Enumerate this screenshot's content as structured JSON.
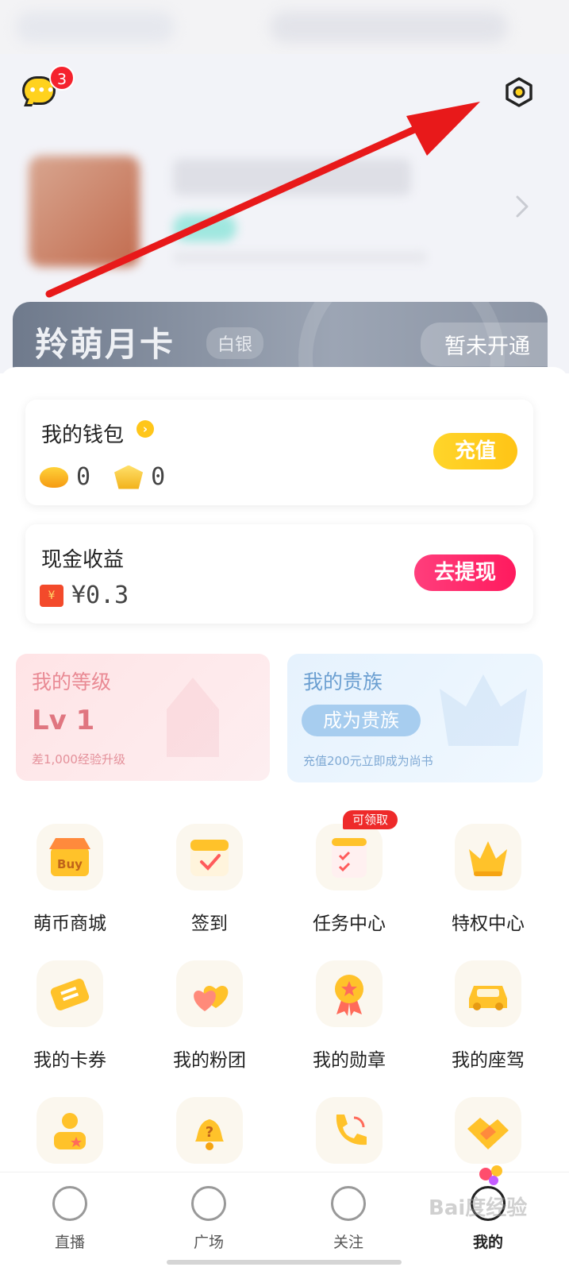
{
  "header": {
    "message_badge": "3",
    "message_icon": "chat-bubble-icon",
    "settings_icon": "gear-icon"
  },
  "moon_card": {
    "title": "羚萌月卡",
    "tier": "白银",
    "status": "暂未开通"
  },
  "wallet": {
    "title": "我的钱包",
    "bean_count": "0",
    "gold_count": "0",
    "recharge_label": "充值"
  },
  "earnings": {
    "title": "现金收益",
    "amount": "¥0.3",
    "withdraw_label": "去提现"
  },
  "level": {
    "title": "我的等级",
    "value": "Lv 1",
    "hint": "差1,000经验升级"
  },
  "noble": {
    "title": "我的贵族",
    "button": "成为贵族",
    "hint": "充值200元立即成为尚书"
  },
  "grid": [
    {
      "label": "萌币商城",
      "icon": "shop-icon"
    },
    {
      "label": "签到",
      "icon": "calendar-check-icon"
    },
    {
      "label": "任务中心",
      "icon": "task-list-icon",
      "badge": "可领取"
    },
    {
      "label": "特权中心",
      "icon": "crown-icon"
    },
    {
      "label": "我的卡券",
      "icon": "ticket-icon"
    },
    {
      "label": "我的粉团",
      "icon": "hearts-icon"
    },
    {
      "label": "我的勋章",
      "icon": "medal-icon"
    },
    {
      "label": "我的座驾",
      "icon": "car-icon"
    },
    {
      "label": "",
      "icon": "user-star-icon"
    },
    {
      "label": "",
      "icon": "bell-question-icon"
    },
    {
      "label": "",
      "icon": "phone-icon"
    },
    {
      "label": "",
      "icon": "handshake-icon"
    }
  ],
  "tabs": [
    {
      "label": "直播",
      "icon": "live-refresh-icon"
    },
    {
      "label": "广场",
      "icon": "compass-icon"
    },
    {
      "label": "关注",
      "icon": "heart-circle-icon"
    },
    {
      "label": "我的",
      "icon": "profile-icon",
      "active": true
    }
  ],
  "watermark": "Bai度经验",
  "colors": {
    "accent_yellow": "#ffc416",
    "withdraw_pink": "#ff1a5e",
    "badge_red": "#f5222d",
    "annotation_arrow": "#e8191a"
  }
}
